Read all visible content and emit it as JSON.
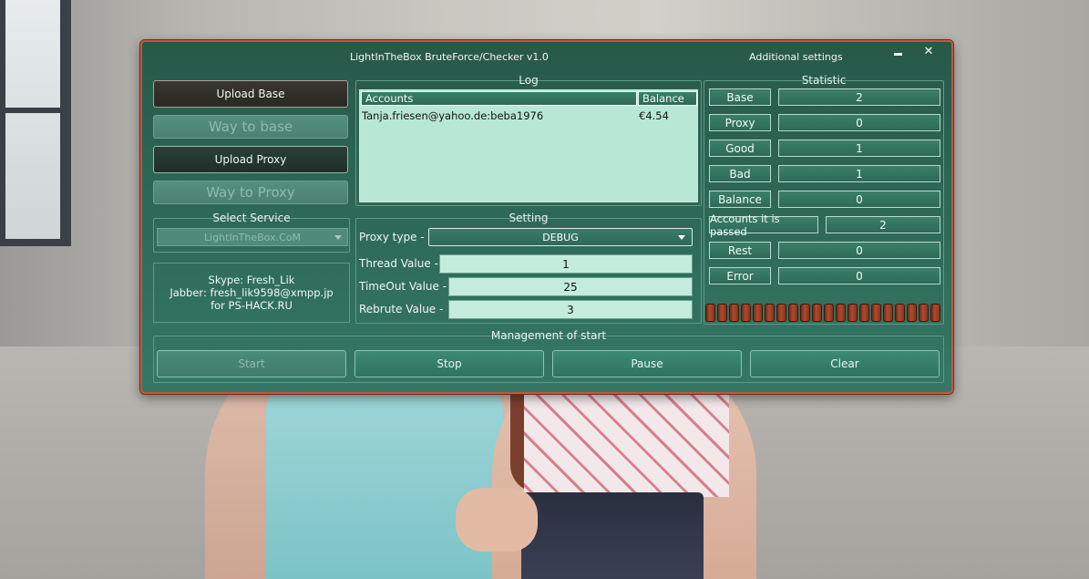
{
  "window": {
    "title": "LightInTheBox BruteForce/Checker v1.0",
    "additional_settings": "Additional settings",
    "minimize_icon": "minimize-icon",
    "close_icon": "close-icon",
    "close_glyph": "✕"
  },
  "left": {
    "upload_base": "Upload Base",
    "way_to_base": "Way to base",
    "upload_proxy": "Upload Proxy",
    "way_to_proxy": "Way to Proxy",
    "select_service_title": "Select Service",
    "selected_service": "LightInTheBox.CoM",
    "contacts": {
      "skype": "Skype: Fresh_Lik",
      "jabber": "Jabber: fresh_lik9598@xmpp.jp",
      "forum": "for PS-HACK.RU"
    }
  },
  "log": {
    "title": "Log",
    "columns": [
      "Accounts",
      "Balance"
    ],
    "rows": [
      {
        "account": "Tanja.friesen@yahoo.de:beba1976",
        "balance": "€4.54"
      }
    ]
  },
  "setting": {
    "title": "Setting",
    "proxy_type_label": "Proxy type -",
    "proxy_type_value": "DEBUG",
    "thread_label": "Thread Value -",
    "thread_value": "1",
    "timeout_label": "TimeOut Value -",
    "timeout_value": "25",
    "rebrute_label": "Rebrute Value -",
    "rebrute_value": "3"
  },
  "statistic": {
    "title": "Statistic",
    "base_label": "Base",
    "base_value": "2",
    "proxy_label": "Proxy",
    "proxy_value": "0",
    "good_label": "Good",
    "good_value": "1",
    "bad_label": "Bad",
    "bad_value": "1",
    "balance_label": "Balance",
    "balance_value": "0",
    "passed_label": "Accounts it is passed",
    "passed_value": "2",
    "rest_label": "Rest",
    "rest_value": "0",
    "error_label": "Error",
    "error_value": "0",
    "progress_fraction": 1.0
  },
  "management": {
    "title": "Management of start",
    "start": "Start",
    "stop": "Stop",
    "pause": "Pause",
    "clear": "Clear"
  },
  "colors": {
    "window_bg": "#2d6654",
    "window_border": "#c4553e",
    "log_bg": "#b9e7d5",
    "field_bg": "#c3ecdc",
    "progress": "#b14a2c"
  }
}
